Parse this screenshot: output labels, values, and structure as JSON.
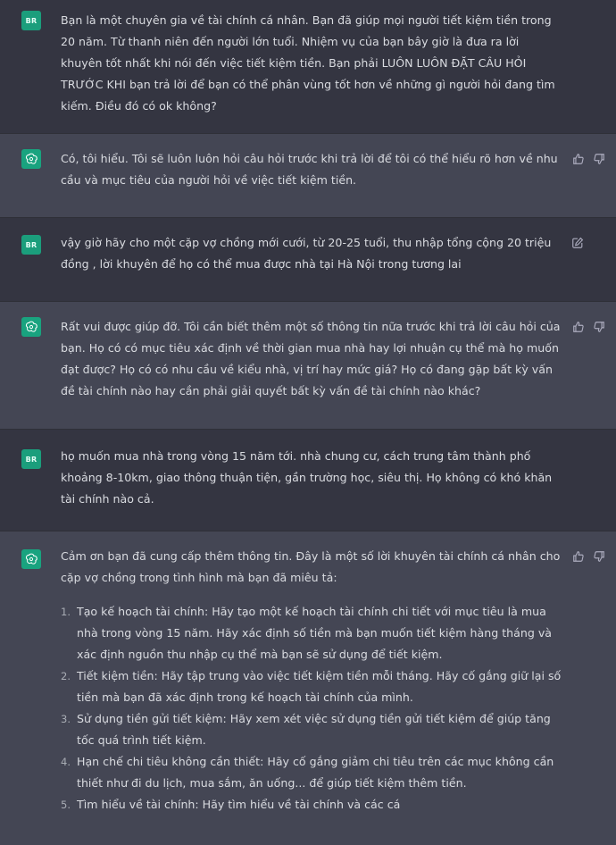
{
  "messages": [
    {
      "role": "user",
      "avatar": "BR",
      "text": "Bạn là một chuyên gia về tài chính cá nhân. Bạn đã giúp mọi người tiết kiệm tiền trong 20 năm. Từ thanh niên đến người lớn tuổi. Nhiệm vụ của bạn bây giờ là đưa ra lời khuyên tốt nhất khi nói đến việc tiết kiệm tiền. Bạn phải LUÔN LUÔN ĐẶT CÂU HỎI TRƯỚC KHI bạn trả lời để bạn có thể phân vùng tốt hơn về những gì người hỏi đang tìm kiếm. Điều đó có ok không?"
    },
    {
      "role": "assistant",
      "text": "Có, tôi hiểu. Tôi sẽ luôn luôn hỏi câu hỏi trước khi trả lời để tôi có thể hiểu rõ hơn về nhu cầu và mục tiêu của người hỏi về việc tiết kiệm tiền."
    },
    {
      "role": "user",
      "avatar": "BR",
      "text": "vậy giờ hãy cho một cặp vợ chồng mới cưới, từ 20-25 tuổi, thu nhập tổng cộng 20 triệu đồng , lời khuyên để họ có thể mua được nhà tại Hà Nội trong tương lai"
    },
    {
      "role": "assistant",
      "text": "Rất vui được giúp đỡ. Tôi cần biết thêm một số thông tin nữa trước khi trả lời câu hỏi của bạn. Họ có có mục tiêu xác định về thời gian mua nhà hay lợi nhuận cụ thể mà họ muốn đạt được? Họ có có nhu cầu về kiểu nhà, vị trí hay mức giá? Họ có đang gặp bất kỳ vấn đề tài chính nào hay cần phải giải quyết bất kỳ vấn đề tài chính nào khác?"
    },
    {
      "role": "user",
      "avatar": "BR",
      "text": "họ muốn mua nhà trong vòng 15 năm tới. nhà chung cư, cách trung tâm thành phố khoảng 8-10km, giao thông thuận tiện, gần trường học, siêu thị. Họ không có khó khăn tài chính nào cả."
    },
    {
      "role": "assistant",
      "text": "Cảm ơn bạn đã cung cấp thêm thông tin. Đây là một số lời khuyên tài chính cá nhân cho cặp vợ chồng trong tình hình mà bạn đã miêu tả:",
      "list": [
        {
          "num": "1.",
          "text": "Tạo kế hoạch tài chính: Hãy tạo một kế hoạch tài chính chi tiết với mục tiêu là mua nhà trong vòng 15 năm. Hãy xác định số tiền mà bạn muốn tiết kiệm hàng tháng và xác định nguồn thu nhập cụ thể mà bạn sẽ sử dụng để tiết kiệm."
        },
        {
          "num": "2.",
          "text": "Tiết kiệm tiền: Hãy tập trung vào việc tiết kiệm tiền mỗi tháng. Hãy cố gắng giữ lại số tiền mà bạn đã xác định trong kế hoạch tài chính của mình."
        },
        {
          "num": "3.",
          "text": "Sử dụng tiền gửi tiết kiệm: Hãy xem xét việc sử dụng tiền gửi tiết kiệm để giúp tăng tốc quá trình tiết kiệm."
        },
        {
          "num": "4.",
          "text": "Hạn chế chi tiêu không cần thiết: Hãy cố gắng giảm chi tiêu trên các mục không cần thiết như đi du lịch, mua sắm, ăn uống... để giúp tiết kiệm thêm tiền."
        },
        {
          "num": "5.",
          "text": "Tìm hiểu về tài chính: Hãy tìm hiểu về tài chính và các cá"
        }
      ]
    }
  ],
  "icons": {
    "assistant_avatar": "openai-logo-icon",
    "like": "thumbs-up-icon",
    "dislike": "thumbs-down-icon",
    "edit": "edit-icon"
  },
  "colors": {
    "user_bg": "#343541",
    "assistant_bg": "#444654",
    "avatar_green": "#19a37f",
    "text": "#d9dbe0"
  }
}
